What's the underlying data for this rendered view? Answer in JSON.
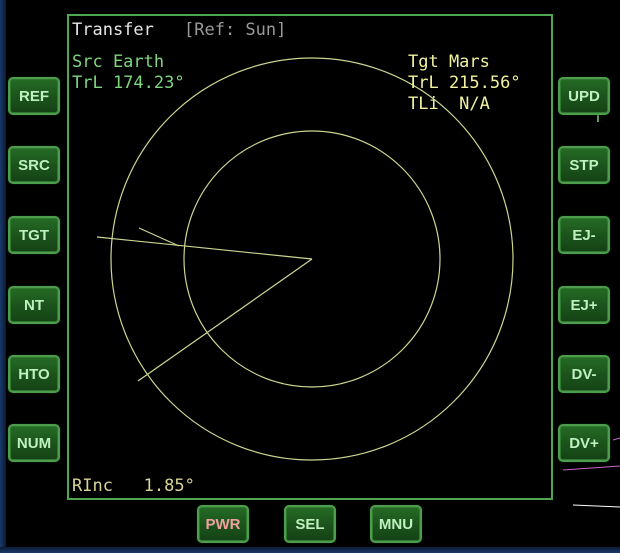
{
  "display": {
    "title": "Transfer",
    "ref_label": "[Ref: Sun]",
    "src_line": "Src Earth",
    "src_trl": "TrL 174.23°",
    "tgt_line": "Tgt Mars",
    "tgt_trl": "TrL 215.56°",
    "tgt_tli": "TLi  N/A",
    "rinc": "RInc   1.85°"
  },
  "left_buttons": [
    "REF",
    "SRC",
    "TGT",
    "NT",
    "HTO",
    "NUM"
  ],
  "right_buttons": [
    "UPD",
    "STP",
    "EJ-",
    "EJ+",
    "DV-",
    "DV+"
  ],
  "bottom_buttons": [
    "PWR",
    "SEL",
    "MNU"
  ],
  "colors": {
    "frame_green": "#4fa84f",
    "button_green": "#1b521b",
    "source_text": "#7ed67e",
    "target_text": "#f2f2a0",
    "orbit_lines": "#c8d890",
    "power_label": "#f0a0a0"
  }
}
